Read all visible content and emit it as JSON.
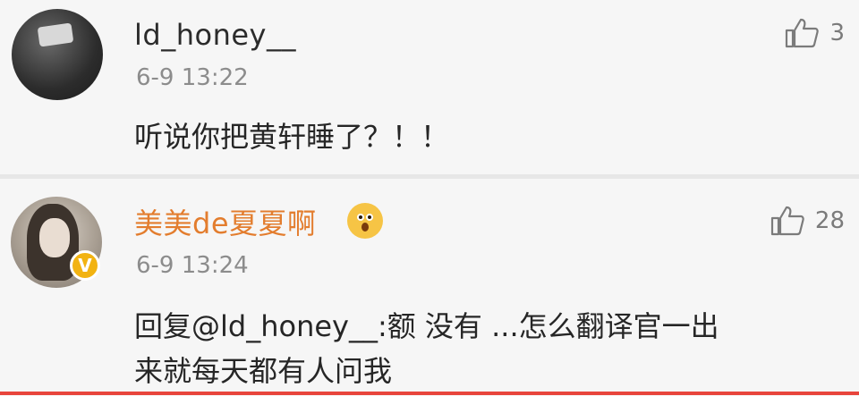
{
  "comments": [
    {
      "username": "ld_honey__",
      "timestamp": "6-9 13:22",
      "likes": "3",
      "text": "听说你把黄轩睡了？！！",
      "avatar_icon": "user-avatar",
      "like_icon": "thumbs-up-icon"
    },
    {
      "username": "美美de夏夏啊",
      "timestamp": "6-9 13:24",
      "likes": "28",
      "text_line1": "回复@ld_honey__:额 没有 ...怎么翻译官一出",
      "text_line2": "来就每天都有人问我",
      "verified_badge": "V",
      "emoji": "😱",
      "avatar_icon": "user-avatar",
      "like_icon": "thumbs-up-icon",
      "username_color": "#e37d2e"
    }
  ]
}
